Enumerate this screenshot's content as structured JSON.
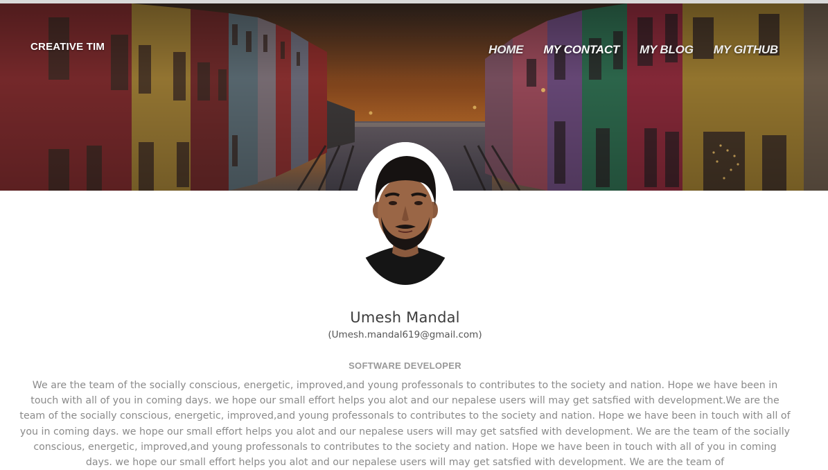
{
  "brand": "CREATIVE TIM",
  "nav": {
    "items": [
      {
        "label": "HOME"
      },
      {
        "label": "MY CONTACT"
      },
      {
        "label": "MY BLOG"
      },
      {
        "label": "MY GITHUB"
      }
    ]
  },
  "profile": {
    "name": "Umesh Mandal",
    "email": "(Umesh.mandal619@gmail.com)",
    "role": "SOFTWARE DEVELOPER",
    "bio": "We are the team of the socially conscious, energetic, improved,and young professonals to contributes to the society and nation. Hope we have been in touch with all of you in coming days. we hope our small effort helps you alot and our nepalese users will may get satsfied with development.We are the team of the socially conscious, energetic, improved,and young professonals to contributes to the society and nation. Hope we have been in touch with all of you in coming days. we hope our small effort helps you alot and our nepalese users will may get satsfied with development. We are the team of the socially conscious, energetic, improved,and young professonals to contributes to the society and nation. Hope we have been in touch with all of you in coming days. we hope our small effort helps you alot and our nepalese users will may get satsfied with development. We are the team of"
  },
  "colors": {
    "header_text": "#ffffff",
    "name_text": "#3c3c3c",
    "role_text": "#999999",
    "bio_text": "#8a8a8a"
  }
}
